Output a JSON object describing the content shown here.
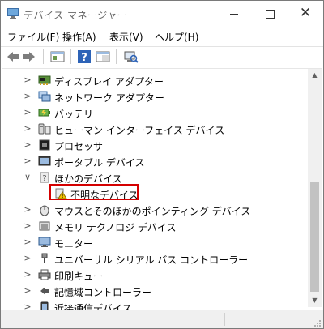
{
  "window": {
    "title": "デバイス マネージャー",
    "minimize_label": "",
    "maximize_label": "",
    "close_label": "✕"
  },
  "menu": {
    "items": [
      {
        "label": "ファイル(F)"
      },
      {
        "label": "操作(A)"
      },
      {
        "label": "表示(V)"
      },
      {
        "label": "ヘルプ(H)"
      }
    ]
  },
  "tree": {
    "items": [
      {
        "label": "ディスプレイ アダプター",
        "icon": "display-adapter-icon",
        "expanded": false
      },
      {
        "label": "ネットワーク アダプター",
        "icon": "network-adapter-icon",
        "expanded": false
      },
      {
        "label": "バッテリ",
        "icon": "battery-icon",
        "expanded": false
      },
      {
        "label": "ヒューマン インターフェイス デバイス",
        "icon": "hid-icon",
        "expanded": false
      },
      {
        "label": "プロセッサ",
        "icon": "processor-icon",
        "expanded": false
      },
      {
        "label": "ポータブル デバイス",
        "icon": "portable-device-icon",
        "expanded": false
      },
      {
        "label": "ほかのデバイス",
        "icon": "other-devices-icon",
        "expanded": true
      },
      {
        "label": "不明なデバイス",
        "icon": "unknown-device-warning-icon",
        "child": true
      },
      {
        "label": "マウスとそのほかのポインティング デバイス",
        "icon": "mouse-icon",
        "expanded": false
      },
      {
        "label": "メモリ テクノロジ デバイス",
        "icon": "memory-tech-icon",
        "expanded": false
      },
      {
        "label": "モニター",
        "icon": "monitor-icon",
        "expanded": false
      },
      {
        "label": "ユニバーサル シリアル バス コントローラー",
        "icon": "usb-icon",
        "expanded": false
      },
      {
        "label": "印刷キュー",
        "icon": "printer-icon",
        "expanded": false
      },
      {
        "label": "記憶域コントローラー",
        "icon": "storage-controller-icon",
        "expanded": false
      },
      {
        "label": "近接通信デバイス",
        "icon": "proximity-device-icon",
        "expanded": false
      }
    ]
  },
  "colors": {
    "highlight_border": "#d40000",
    "warning": "#f5c400"
  }
}
